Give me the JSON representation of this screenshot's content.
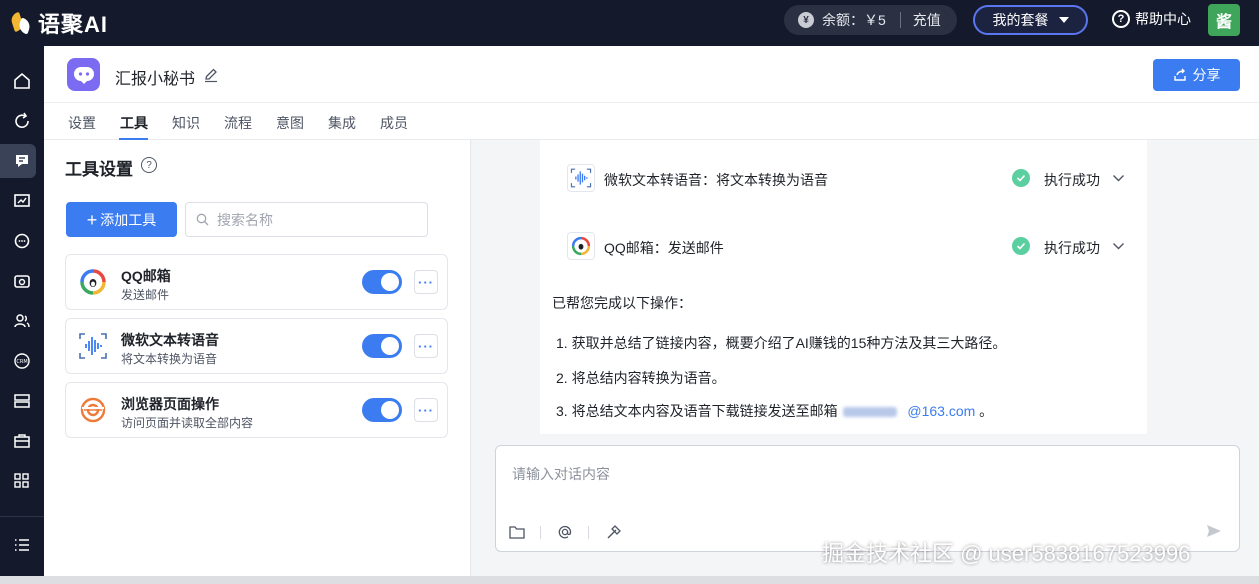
{
  "topbar": {
    "logo_text": "语聚AI",
    "balance_label": "余额：￥5",
    "recharge_label": "充值",
    "plan_label": "我的套餐",
    "help_label": "帮助中心",
    "avatar_text": "酱"
  },
  "header": {
    "app_title": "汇报小秘书",
    "share_label": "分享"
  },
  "tabs": [
    "设置",
    "工具",
    "知识",
    "流程",
    "意图",
    "集成",
    "成员"
  ],
  "panel": {
    "title": "工具设置",
    "add_label": "添加工具",
    "search_placeholder": "搜索名称",
    "tools": [
      {
        "name": "QQ邮箱",
        "desc": "发送邮件",
        "enabled": true
      },
      {
        "name": "微软文本转语音",
        "desc": "将文本转换为语音",
        "enabled": true
      },
      {
        "name": "浏览器页面操作",
        "desc": "访问页面并读取全部内容",
        "enabled": true
      }
    ]
  },
  "chat": {
    "executions": [
      {
        "label": "微软文本转语音：将文本转换为语音",
        "status": "执行成功"
      },
      {
        "label": "QQ邮箱：发送邮件",
        "status": "执行成功"
      }
    ],
    "done_text": "已帮您完成以下操作：",
    "steps": [
      "1. 获取并总结了链接内容，概要介绍了AI赚钱的15种方法及其三大路径。",
      "2. 将总结内容转换为语音。",
      "3. 将总结文本内容及语音下载链接发送至邮箱"
    ],
    "mail_domain": "@163.com",
    "mail_suffix": "。",
    "input_placeholder": "请输入对话内容"
  },
  "watermark": "掘金技术社区 @ user5838167523996",
  "colors": {
    "topbar_bg": "#141a2b",
    "accent": "#3b7cf0",
    "success": "#5ccfa1",
    "avatar_bg": "#3fa55a",
    "app_icon_bg": "#7b6bf2"
  },
  "icons": {
    "rail": [
      "home-icon",
      "refresh-icon",
      "chat-icon",
      "chart-icon",
      "message-icon",
      "package-icon",
      "users-icon",
      "crm-icon",
      "database-icon",
      "briefcase-icon",
      "apps-icon",
      "menu-icon"
    ],
    "input_tools": [
      "folder-icon",
      "at-icon",
      "magic-wand-icon"
    ]
  }
}
